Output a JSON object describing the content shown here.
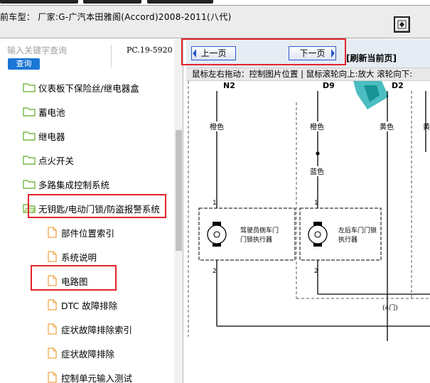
{
  "header": {
    "vehicle_text": "前车型： 厂家:G-广汽本田雅阁(Accord)2008-2011(八代)",
    "icon": "sync-icon"
  },
  "search": {
    "placeholder": "输入关键字查询",
    "button_label": "查询",
    "pc_code": "PC.19-5920"
  },
  "tree": {
    "items": [
      {
        "label": "仪表板下保险丝/继电器盒",
        "icon": "folder-icon"
      },
      {
        "label": "蓄电池",
        "icon": "folder-icon"
      },
      {
        "label": "继电器",
        "icon": "folder-icon"
      },
      {
        "label": "点火开关",
        "icon": "folder-icon"
      },
      {
        "label": "多路集成控制系统",
        "icon": "folder-icon"
      },
      {
        "label": "无钥匙/电动门锁/防盗报警系统",
        "icon": "folder-open-icon"
      },
      {
        "label": "部件位置索引",
        "icon": "document-icon"
      },
      {
        "label": "系统说明",
        "icon": "document-icon"
      },
      {
        "label": "电路图",
        "icon": "document-icon"
      },
      {
        "label": "DTC 故障排除",
        "icon": "document-icon"
      },
      {
        "label": "症状故障排除索引",
        "icon": "document-icon"
      },
      {
        "label": "症状故障排除",
        "icon": "document-icon"
      },
      {
        "label": "控制单元输入测试",
        "icon": "document-icon"
      }
    ]
  },
  "viewer": {
    "prev_label": "上一页",
    "next_label": "下一页",
    "refresh_label": "[刷新当前页]",
    "hint": "鼠标左右拖动：控制图片位置 | 鼠标滚轮向上:放大  滚轮向下:"
  },
  "diagram": {
    "connectors": [
      "N2",
      "D9",
      "D2"
    ],
    "wire_colors": [
      "橙色",
      "橙色",
      "蓝色",
      "黄色",
      "黄"
    ],
    "pin_labels": [
      "1",
      "2",
      "1",
      "2"
    ],
    "actuators": [
      {
        "line1": "驾驶员侧车门",
        "line2": "门锁执行器"
      },
      {
        "line1": "左后车门门锁",
        "line2": "执行器"
      }
    ],
    "note": "(4门)"
  },
  "colors": {
    "accent_blue": "#1b76d6",
    "highlight_red": "#e2242a",
    "folder_green": "#7ab648",
    "document_orange": "#f0a64a",
    "watermark_teal": "#2bb3b6"
  }
}
